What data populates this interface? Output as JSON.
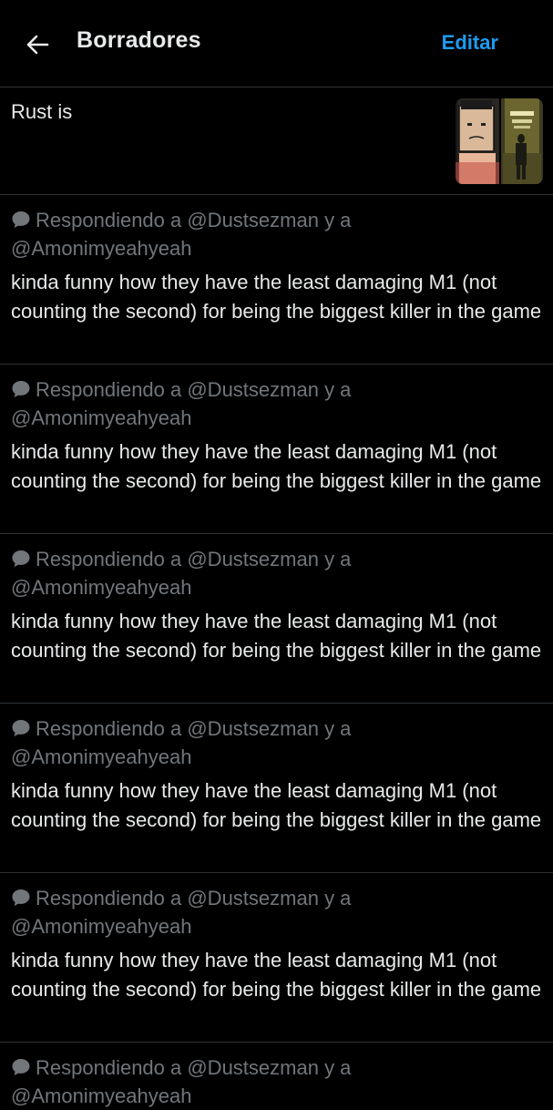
{
  "header": {
    "title": "Borradores",
    "edit_label": "Editar"
  },
  "drafts": [
    {
      "text": "Rust is",
      "has_media": true
    },
    {
      "reply_prefix": "Respondiendo a @Dustsezman y a",
      "reply_second": "@Amonimyeahyeah",
      "text": "kinda funny how they have the least damaging M1 (not counting the second) for being the biggest killer in the game"
    },
    {
      "reply_prefix": "Respondiendo a @Dustsezman y a",
      "reply_second": "@Amonimyeahyeah",
      "text": "kinda funny how they have the least damaging M1 (not counting the second) for being the biggest killer in the game"
    },
    {
      "reply_prefix": "Respondiendo a @Dustsezman y a",
      "reply_second": "@Amonimyeahyeah",
      "text": "kinda funny how they have the least damaging M1 (not counting the second) for being the biggest killer in the game"
    },
    {
      "reply_prefix": "Respondiendo a @Dustsezman y a",
      "reply_second": "@Amonimyeahyeah",
      "text": "kinda funny how they have the least damaging M1 (not counting the second) for being the biggest killer in the game"
    },
    {
      "reply_prefix": "Respondiendo a @Dustsezman y a",
      "reply_second": "@Amonimyeahyeah",
      "text": "kinda funny how they have the least damaging M1 (not counting the second) for being the biggest killer in the game"
    },
    {
      "reply_prefix": "Respondiendo a @Dustsezman y a",
      "reply_second": "@Amonimyeahyeah",
      "text": ""
    }
  ],
  "colors": {
    "background": "#000000",
    "accent": "#1d9bf0",
    "muted_text": "#71767b",
    "divider": "#2f3336"
  },
  "icons": {
    "back": "arrow-left-icon",
    "reply": "speech-bubble-icon"
  }
}
